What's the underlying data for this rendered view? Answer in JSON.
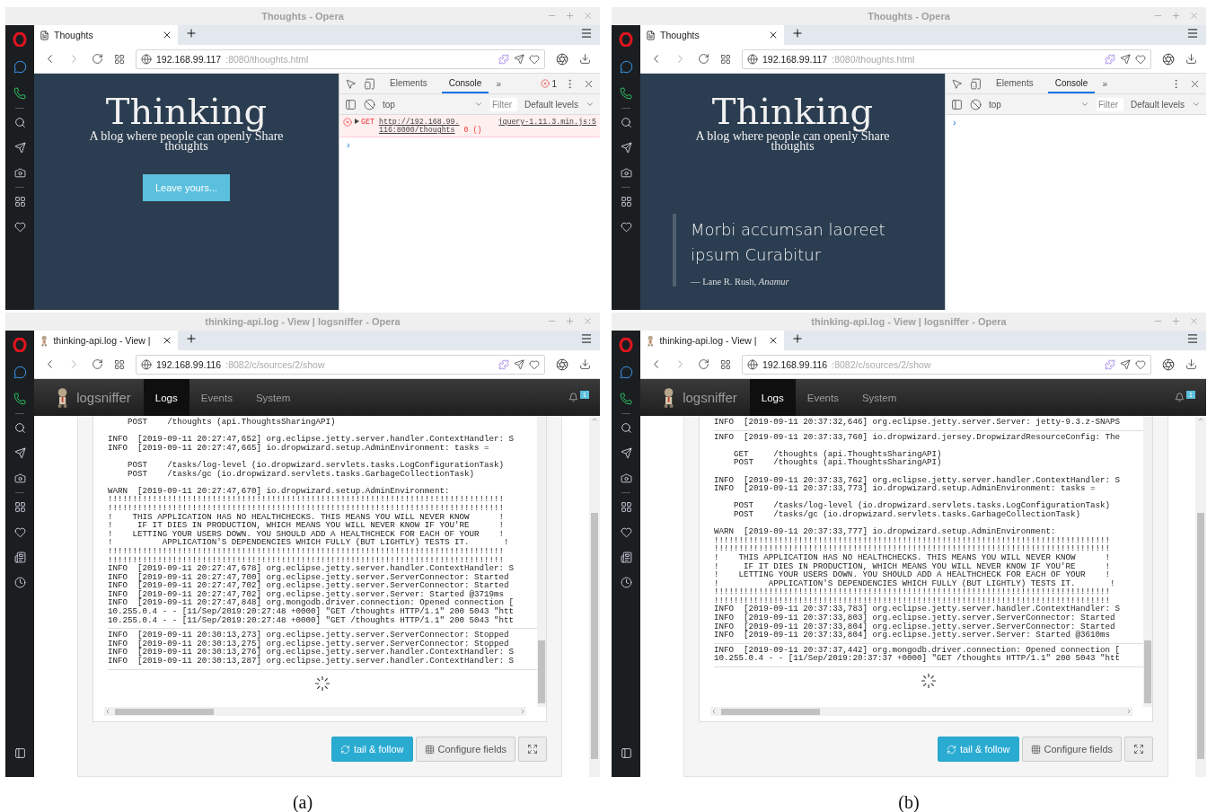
{
  "figures": [
    {
      "caption": "(a)",
      "blog_window": {
        "title": "Thoughts - Opera",
        "tab": "Thoughts",
        "host": "192.168.99.117",
        "path": ":8080/thoughts.html",
        "heading": "Thinking",
        "tagline": "A blog where people can openly Share thoughts",
        "button": "Leave yours...",
        "devtools": {
          "tabs": [
            {
              "label": "Elements",
              "selected": false
            },
            {
              "label": "Console",
              "selected": true
            }
          ],
          "overflow": "»",
          "error_count": "1",
          "context": "top",
          "filter_placeholder": "Filter",
          "levels": "Default levels",
          "messages": [
            {
              "kind": "error",
              "method": "GET",
              "url_lines": [
                "http://192.168.99.",
                "116:8000/thoughts"
              ],
              "status": "0 ()",
              "source": "jquery-1.11.3.min.js:5"
            }
          ],
          "prompt": "›"
        }
      },
      "log_window": {
        "title": "thinking-api.log - View | logsniffer - Opera",
        "tab": "thinking-api.log - View |",
        "host": "192.168.99.116",
        "path": ":8082/c/sources/2/show",
        "brand": "logsniffer",
        "nav": [
          {
            "label": "Logs",
            "selected": true
          },
          {
            "label": "Events",
            "selected": false
          },
          {
            "label": "System",
            "selected": false
          }
        ],
        "notification_count": "1",
        "log_sections": [
          [
            [
              "    POST    /thoughts (api.ThoughtsSharingAPI)"
            ],
            [
              "INFO  [2019-09-11 20:27:47,652] org.eclipse.jetty.server.handler.ContextHandler: S",
              "INFO  [2019-09-11 20:27:47,665] io.dropwizard.setup.AdminEnvironment: tasks ="
            ],
            [
              "    POST    /tasks/log-level (io.dropwizard.servlets.tasks.LogConfigurationTask)",
              "    POST    /tasks/gc (io.dropwizard.servlets.tasks.GarbageCollectionTask)"
            ],
            [
              "WARN  [2019-09-11 20:27:47,670] io.dropwizard.setup.AdminEnvironment:",
              "!!!!!!!!!!!!!!!!!!!!!!!!!!!!!!!!!!!!!!!!!!!!!!!!!!!!!!!!!!!!!!!!!!!!!!!!!!!!!!!!",
              "!!!!!!!!!!!!!!!!!!!!!!!!!!!!!!!!!!!!!!!!!!!!!!!!!!!!!!!!!!!!!!!!!!!!!!!!!!!!!!!!",
              "!    THIS APPLICATION HAS NO HEALTHCHECKS. THIS MEANS YOU WILL NEVER KNOW      !",
              "!     IF IT DIES IN PRODUCTION, WHICH MEANS YOU WILL NEVER KNOW IF YOU'RE      !",
              "!    LETTING YOUR USERS DOWN. YOU SHOULD ADD A HEALTHCHECK FOR EACH OF YOUR    !",
              "!          APPLICATION'S DEPENDENCIES WHICH FULLY (BUT LIGHTLY) TESTS IT.       !",
              "!!!!!!!!!!!!!!!!!!!!!!!!!!!!!!!!!!!!!!!!!!!!!!!!!!!!!!!!!!!!!!!!!!!!!!!!!!!!!!!!",
              "!!!!!!!!!!!!!!!!!!!!!!!!!!!!!!!!!!!!!!!!!!!!!!!!!!!!!!!!!!!!!!!!!!!!!!!!!!!!!!!!",
              "INFO  [2019-09-11 20:27:47,678] org.eclipse.jetty.server.handler.ContextHandler: S",
              "INFO  [2019-09-11 20:27:47,700] org.eclipse.jetty.server.ServerConnector: Started",
              "INFO  [2019-09-11 20:27:47,702] org.eclipse.jetty.server.ServerConnector: Started",
              "INFO  [2019-09-11 20:27:47,702] org.eclipse.jetty.server.Server: Started @3719ms",
              "INFO  [2019-09-11 20:27:47,848] org.mongodb.driver.connection: Opened connection [",
              "10.255.0.4 - - [11/Sep/2019:20:27:48 +0000] \"GET /thoughts HTTP/1.1\" 200 5043 \"htt",
              "10.255.0.4 - - [11/Sep/2019:20:27:48 +0000] \"GET /thoughts HTTP/1.1\" 200 5043 \"htt"
            ]
          ],
          [
            [
              "INFO  [2019-09-11 20:30:13,273] org.eclipse.jetty.server.ServerConnector: Stopped",
              "INFO  [2019-09-11 20:30:13,275] org.eclipse.jetty.server.ServerConnector: Stopped",
              "INFO  [2019-09-11 20:30:13,276] org.eclipse.jetty.server.handler.ContextHandler: S",
              "INFO  [2019-09-11 20:30:13,287] org.eclipse.jetty.server.handler.ContextHandler: S"
            ]
          ]
        ],
        "buttons": [
          {
            "kind": "primary",
            "label": "tail & follow"
          },
          {
            "kind": "default",
            "label": "Configure fields"
          },
          {
            "kind": "icon"
          }
        ]
      }
    },
    {
      "caption": "(b)",
      "blog_window": {
        "title": "Thoughts - Opera",
        "tab": "Thoughts",
        "host": "192.168.99.117",
        "path": ":8080/thoughts.html",
        "heading": "Thinking",
        "tagline": "A blog where people can openly Share thoughts",
        "quote": {
          "text": "Morbi accumsan laoreet ipsum Curabitur",
          "attribution": "— Lane R. Rush, *Anamur*"
        },
        "devtools": {
          "tabs": [
            {
              "label": "Elements",
              "selected": false
            },
            {
              "label": "Console",
              "selected": true
            }
          ],
          "overflow": "»",
          "context": "top",
          "filter_placeholder": "Filter",
          "levels": "Default levels",
          "prompt": "›"
        }
      },
      "log_window": {
        "title": "thinking-api.log - View | logsniffer - Opera",
        "tab": "thinking-api.log - View |",
        "host": "192.168.99.116",
        "path": ":8082/c/sources/2/show",
        "brand": "logsniffer",
        "nav": [
          {
            "label": "Logs",
            "selected": true
          },
          {
            "label": "Events",
            "selected": false
          },
          {
            "label": "System",
            "selected": false
          }
        ],
        "notification_count": "1",
        "log_sections": [
          [
            [
              "INFO  [2019-09-11 20:37:32,646] org.eclipse.jetty.server.Server: jetty-9.3.z-SNAPS"
            ]
          ],
          [
            [
              "INFO  [2019-09-11 20:37:33,760] io.dropwizard.jersey.DropwizardResourceConfig: The"
            ],
            [
              "    GET     /thoughts (api.ThoughtsSharingAPI)",
              "    POST    /thoughts (api.ThoughtsSharingAPI)"
            ],
            [
              "INFO  [2019-09-11 20:37:33,762] org.eclipse.jetty.server.handler.ContextHandler: S",
              "INFO  [2019-09-11 20:37:33,773] io.dropwizard.setup.AdminEnvironment: tasks ="
            ],
            [
              "    POST    /tasks/log-level (io.dropwizard.servlets.tasks.LogConfigurationTask)",
              "    POST    /tasks/gc (io.dropwizard.servlets.tasks.GarbageCollectionTask)"
            ],
            [
              "WARN  [2019-09-11 20:37:33,777] io.dropwizard.setup.AdminEnvironment:",
              "!!!!!!!!!!!!!!!!!!!!!!!!!!!!!!!!!!!!!!!!!!!!!!!!!!!!!!!!!!!!!!!!!!!!!!!!!!!!!!!!",
              "!!!!!!!!!!!!!!!!!!!!!!!!!!!!!!!!!!!!!!!!!!!!!!!!!!!!!!!!!!!!!!!!!!!!!!!!!!!!!!!!",
              "!    THIS APPLICATION HAS NO HEALTHCHECKS. THIS MEANS YOU WILL NEVER KNOW      !",
              "!     IF IT DIES IN PRODUCTION, WHICH MEANS YOU WILL NEVER KNOW IF YOU'RE      !",
              "!    LETTING YOUR USERS DOWN. YOU SHOULD ADD A HEALTHCHECK FOR EACH OF YOUR    !",
              "!          APPLICATION'S DEPENDENCIES WHICH FULLY (BUT LIGHTLY) TESTS IT.       !",
              "!!!!!!!!!!!!!!!!!!!!!!!!!!!!!!!!!!!!!!!!!!!!!!!!!!!!!!!!!!!!!!!!!!!!!!!!!!!!!!!!",
              "!!!!!!!!!!!!!!!!!!!!!!!!!!!!!!!!!!!!!!!!!!!!!!!!!!!!!!!!!!!!!!!!!!!!!!!!!!!!!!!!",
              "INFO  [2019-09-11 20:37:33,783] org.eclipse.jetty.server.handler.ContextHandler: S",
              "INFO  [2019-09-11 20:37:33,803] org.eclipse.jetty.server.ServerConnector: Started",
              "INFO  [2019-09-11 20:37:33,804] org.eclipse.jetty.server.ServerConnector: Started",
              "INFO  [2019-09-11 20:37:33,804] org.eclipse.jetty.server.Server: Started @3610ms"
            ]
          ],
          [
            [
              "INFO  [2019-09-11 20:37:37,442] org.mongodb.driver.connection: Opened connection [",
              "10.255.0.4 - - [11/Sep/2019:20:37:37 +0000] \"GET /thoughts HTTP/1.1\" 200 5043 \"htt"
            ]
          ]
        ],
        "buttons": [
          {
            "kind": "primary",
            "label": "tail & follow"
          },
          {
            "kind": "default",
            "label": "Configure fields"
          },
          {
            "kind": "icon"
          }
        ]
      }
    }
  ]
}
